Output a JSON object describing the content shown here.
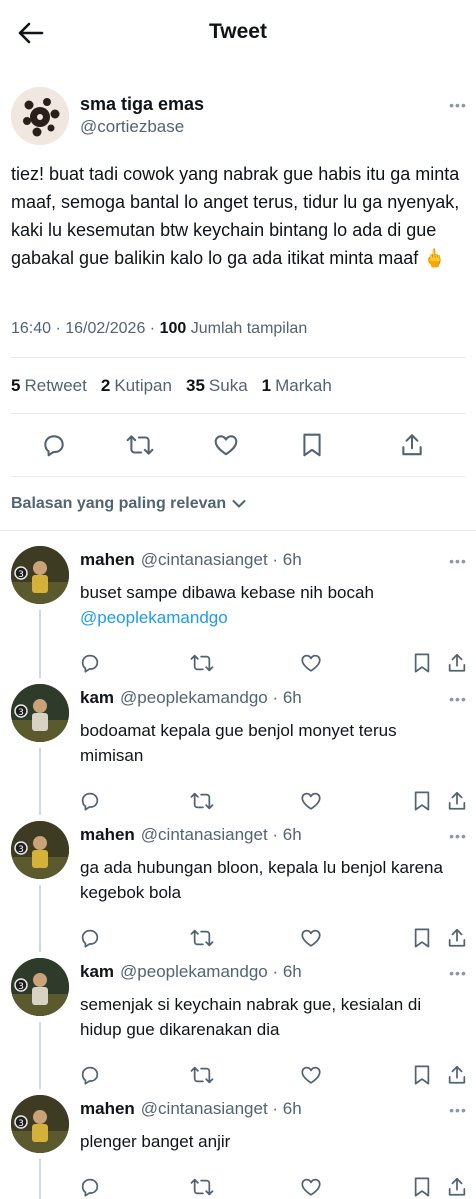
{
  "header": {
    "title": "Tweet"
  },
  "tweet": {
    "author_name": "sma tiga emas",
    "author_handle": "@cortiezbase",
    "text": "tiez! buat tadi cowok yang nabrak gue habis itu ga minta maaf, semoga bantal lo anget terus, tidur lu ga nyenyak, kaki lu kesemutan btw keychain bintang lo ada di gue gabakal gue balikin kalo lo ga ada itikat minta maaf 🖕",
    "time": "16:40 · 16/02/2026 · ",
    "views_count": "100",
    "views_label": " Jumlah tampilan",
    "stats": [
      {
        "count": "5",
        "label": "Retweet"
      },
      {
        "count": "2",
        "label": "Kutipan"
      },
      {
        "count": "35",
        "label": "Suka"
      },
      {
        "count": "1",
        "label": "Markah"
      }
    ]
  },
  "sort": {
    "label": "Balasan yang paling relevan"
  },
  "replies": [
    {
      "name": "mahen",
      "handle": "@cintanasianget · 6h",
      "text": "buset sampe dibawa kebase nih bocah ",
      "mention": "@peoplekamandgo"
    },
    {
      "name": "kam",
      "handle": "@peoplekamandgo · 6h",
      "text": "bodoamat kepala gue benjol monyet terus mimisan",
      "mention": ""
    },
    {
      "name": "mahen",
      "handle": "@cintanasianget · 6h",
      "text": "ga ada hubungan bloon, kepala lu benjol karena kegebok bola",
      "mention": ""
    },
    {
      "name": "kam",
      "handle": "@peoplekamandgo · 6h",
      "text": "semenjak si keychain nabrak gue, kesialan di hidup gue dikarenakan dia",
      "mention": ""
    },
    {
      "name": "mahen",
      "handle": "@cintanasianget · 6h",
      "text": "plenger banget anjir",
      "mention": ""
    }
  ],
  "icons": {
    "back": "arrow-left-icon",
    "more": "more-horizontal-icon",
    "reply": "reply-icon",
    "retweet": "retweet-icon",
    "like": "heart-icon",
    "bookmark": "bookmark-icon",
    "share": "share-icon",
    "sort": "chevron-down-icon"
  },
  "colors": {
    "text": "#0f1419",
    "secondary": "#536471",
    "link": "#1d9bf0",
    "divider": "#e7ebee"
  }
}
